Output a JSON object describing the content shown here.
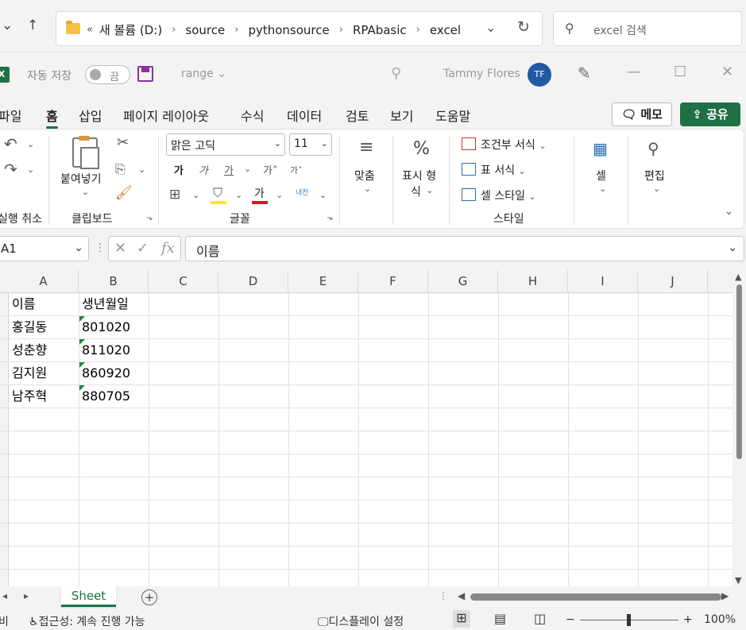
{
  "explorer": {
    "breadcrumb": [
      "새 볼륨 (D:)",
      "source",
      "pythonsource",
      "RPAbasic",
      "excel"
    ],
    "search_placeholder": "excel 검색"
  },
  "titlebar": {
    "autosave_label": "자동 저장",
    "autosave_state": "끔",
    "filename": "range",
    "user_name": "Tammy Flores",
    "user_initials": "TF"
  },
  "tabs": [
    "파일",
    "홈",
    "삽입",
    "페이지 레이아웃",
    "수식",
    "데이터",
    "검토",
    "보기",
    "도움말"
  ],
  "active_tab": "홈",
  "memo_label": "메모",
  "share_label": "공유",
  "ribbon": {
    "undo_label": "실행 취소",
    "paste_label": "붙여넣기",
    "clipboard_label": "클립보드",
    "font_name": "맑은 고딕",
    "font_size": "11",
    "font_label": "글꼴",
    "align_label": "맞춤",
    "number_label_1": "표시 형",
    "number_label_2": "식",
    "cond_format": "조건부 서식",
    "table_format": "표 서식",
    "cell_style": "셀 스타일",
    "style_label": "스타일",
    "cells_label": "셀",
    "edit_label": "편집",
    "bold": "가",
    "italic": "가",
    "underline": "가",
    "grow": "가",
    "shrink": "가",
    "font_color_glyph": "가",
    "phonetic": "내천"
  },
  "formula_bar": {
    "name_box": "A1",
    "formula": "이름"
  },
  "columns": [
    "A",
    "B",
    "C",
    "D",
    "E",
    "F",
    "G",
    "H",
    "I",
    "J"
  ],
  "rows": [
    [
      "이름",
      "생년월일"
    ],
    [
      "홍길동",
      "801020"
    ],
    [
      "성춘향",
      "811020"
    ],
    [
      "김지원",
      "860920"
    ],
    [
      "남주혁",
      "880705"
    ]
  ],
  "sheet_tab": "Sheet",
  "status": {
    "ready": "비",
    "accessibility": "접근성: 계속 진행 가능",
    "display_settings": "디스플레이 설정",
    "zoom": "100%"
  }
}
